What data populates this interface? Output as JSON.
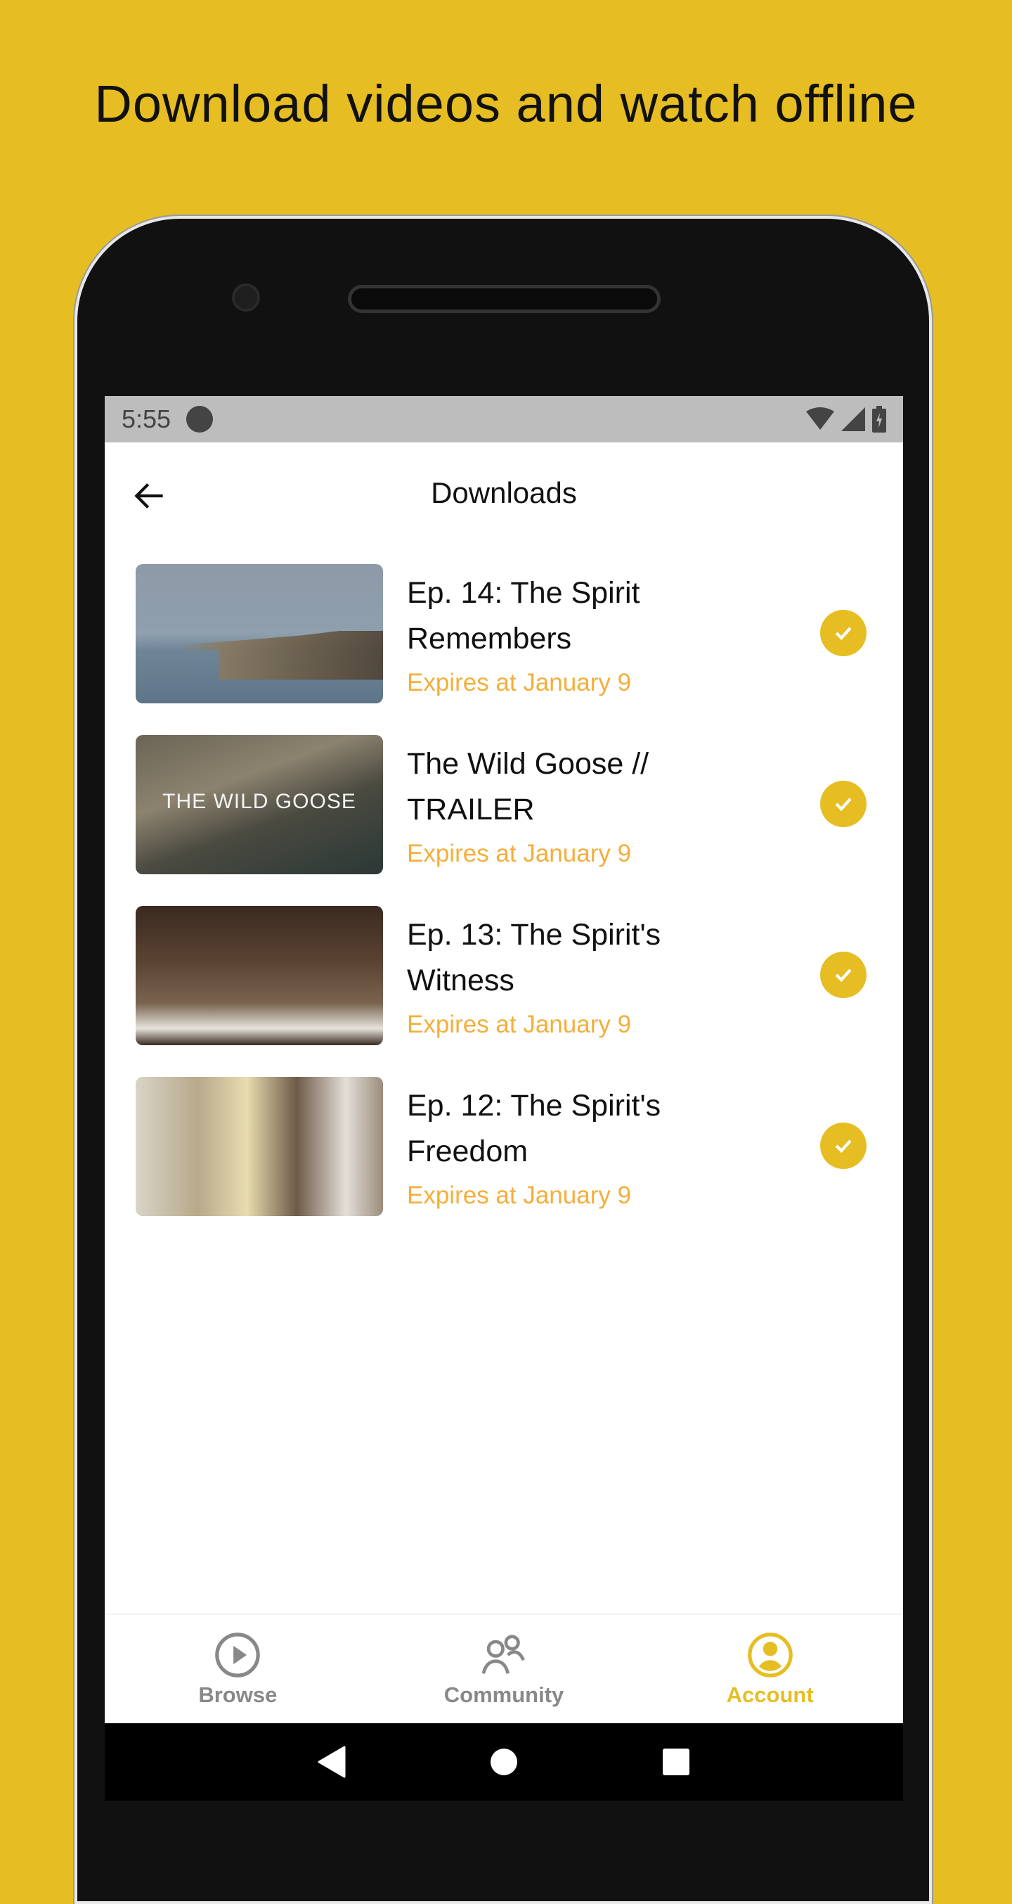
{
  "headline": "Download videos and watch offline",
  "status_bar": {
    "time": "5:55"
  },
  "app_bar": {
    "title": "Downloads"
  },
  "downloads": [
    {
      "title": "Ep. 14: The Spirit Remembers",
      "expires": "Expires at January 9",
      "downloaded": true
    },
    {
      "title": "The Wild Goose // TRAILER",
      "expires": "Expires at January 9",
      "downloaded": true,
      "thumb_text": "THE WILD GOOSE"
    },
    {
      "title": "Ep. 13: The Spirit's Witness",
      "expires": "Expires at January 9",
      "downloaded": true
    },
    {
      "title": "Ep. 12: The Spirit's Freedom",
      "expires": "Expires at January 9",
      "downloaded": true
    }
  ],
  "bottom_nav": {
    "items": [
      {
        "label": "Browse",
        "icon": "play-circle-icon",
        "active": false
      },
      {
        "label": "Community",
        "icon": "people-icon",
        "active": false
      },
      {
        "label": "Account",
        "icon": "account-icon",
        "active": true
      }
    ]
  },
  "colors": {
    "background": "#E6BE23",
    "accent": "#E6BE23",
    "expires": "#F5AE3B",
    "inactive": "#888888"
  }
}
